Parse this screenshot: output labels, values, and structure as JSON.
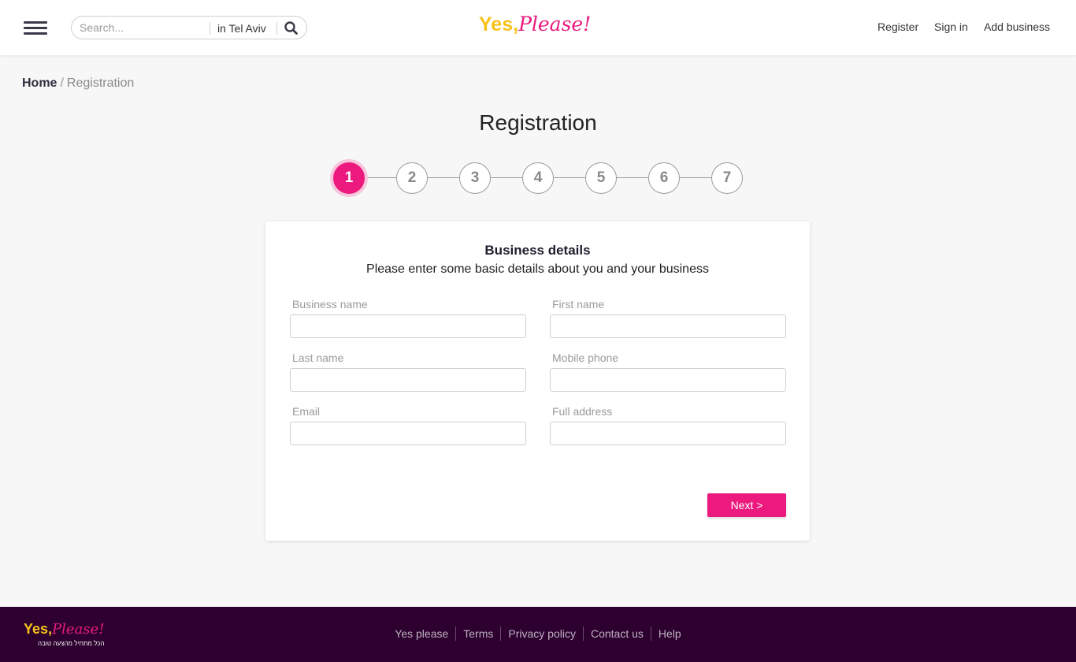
{
  "header": {
    "search": {
      "placeholder": "Search...",
      "value": "",
      "location": "in Tel Aviv"
    },
    "logo": {
      "yes": "Yes,",
      "please": "Please!"
    },
    "nav": {
      "register": "Register",
      "sign_in": "Sign in",
      "add_business": "Add business"
    }
  },
  "breadcrumb": {
    "home": "Home",
    "separator": "/",
    "current": "Registration"
  },
  "page_title": "Registration",
  "stepper": {
    "steps": [
      "1",
      "2",
      "3",
      "4",
      "5",
      "6",
      "7"
    ],
    "active_step": 1
  },
  "form": {
    "title": "Business details",
    "subtitle": "Please enter some basic details about you and your business",
    "fields": {
      "business_name": {
        "label": "Business name",
        "value": ""
      },
      "first_name": {
        "label": "First name",
        "value": ""
      },
      "last_name": {
        "label": "Last name",
        "value": ""
      },
      "mobile_phone": {
        "label": "Mobile phone",
        "value": ""
      },
      "email": {
        "label": "Email",
        "value": ""
      },
      "full_address": {
        "label": "Full address",
        "value": ""
      }
    },
    "next_label": "Next >"
  },
  "footer": {
    "logo": {
      "yes": "Yes,",
      "please": "Please!"
    },
    "tagline": "הכל מתחיל מהצעה טובה",
    "links": [
      "Yes please",
      "Terms",
      "Privacy policy",
      "Contact us",
      "Help"
    ]
  },
  "colors": {
    "accent": "#ec1a7e",
    "logo_yellow": "#f7c21a",
    "footer_bg": "#2d002f"
  },
  "icons": {
    "menu": "hamburger-menu-icon",
    "search": "search-icon"
  }
}
